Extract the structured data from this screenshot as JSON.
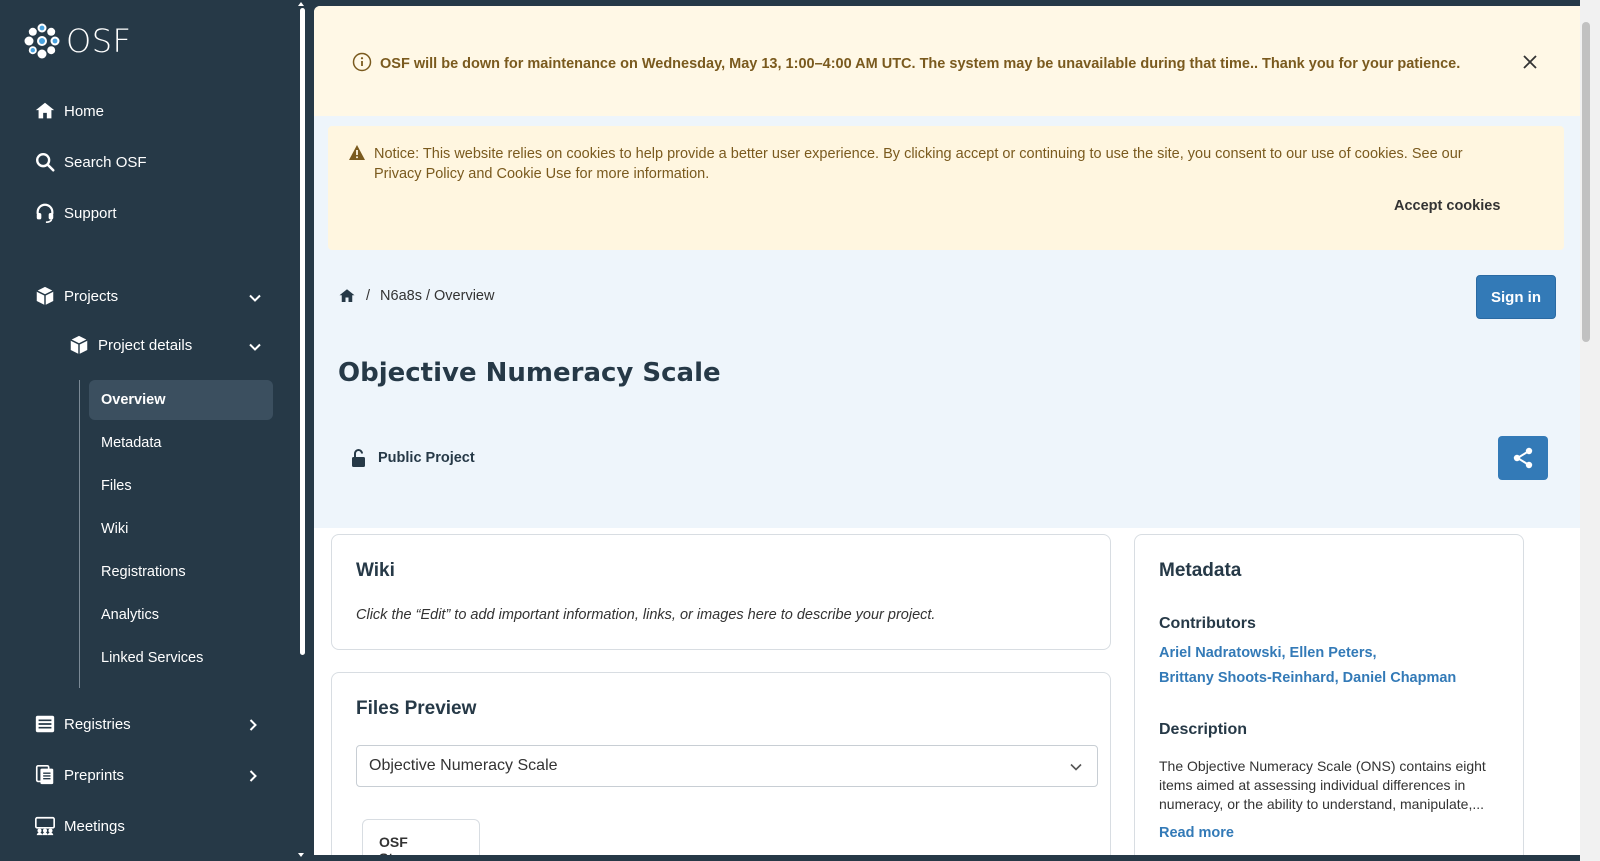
{
  "brand": {
    "name": "OSF"
  },
  "sidebar": {
    "nav": [
      {
        "label": "Home",
        "icon": "home-icon"
      },
      {
        "label": "Search OSF",
        "icon": "search-icon"
      },
      {
        "label": "Support",
        "icon": "headset-icon"
      }
    ],
    "projects": {
      "label": "Projects",
      "icon": "cube-icon",
      "expanded": true
    },
    "project_details": {
      "label": "Project details",
      "icon": "cube-icon",
      "expanded": true
    },
    "leaves": [
      "Overview",
      "Metadata",
      "Files",
      "Wiki",
      "Registrations",
      "Analytics",
      "Linked Services"
    ],
    "active_leaf": "Overview",
    "bottom": [
      {
        "label": "Registries",
        "icon": "list-icon"
      },
      {
        "label": "Preprints",
        "icon": "document-icon"
      },
      {
        "label": "Meetings",
        "icon": "people-icon"
      }
    ]
  },
  "maintenance": {
    "text": "OSF will be down for maintenance on Wednesday, May 13, 1:00–4:00 AM UTC. The system may be unavailable during that time.. Thank you for your patience."
  },
  "cookie": {
    "text": "Notice: This website relies on cookies to help provide a better user experience. By clicking accept or continuing to use the site, you consent to our use of cookies. See our Privacy Policy and Cookie Use for more information.",
    "accept_label": "Accept cookies"
  },
  "breadcrumb": {
    "separator": "/",
    "path": "N6a8s / Overview"
  },
  "signin_label": "Sign in",
  "project": {
    "title": "Objective Numeracy Scale",
    "visibility": "Public Project"
  },
  "wiki": {
    "title": "Wiki",
    "body": "Click the “Edit” to add important information, links, or images here to describe your project."
  },
  "files_preview": {
    "title": "Files Preview",
    "selected": "Objective Numeracy Scale",
    "storage_tab": "OSF Storage"
  },
  "metadata": {
    "title": "Metadata",
    "contributors_label": "Contributors",
    "contributors_line1": "Ariel Nadratowski, Ellen Peters,",
    "contributors_line2": "Brittany Shoots-Reinhard, Daniel Chapman",
    "description_label": "Description",
    "description": "The Objective Numeracy Scale (ONS) contains eight items aimed at assessing individual differences in numeracy, or the ability to understand, manipulate,...",
    "read_more": "Read more"
  },
  "colors": {
    "sidebar_bg": "#263947",
    "primary": "#337ab7",
    "banner_bg": "#fff8e6",
    "banner_text": "#7a5a1e"
  }
}
